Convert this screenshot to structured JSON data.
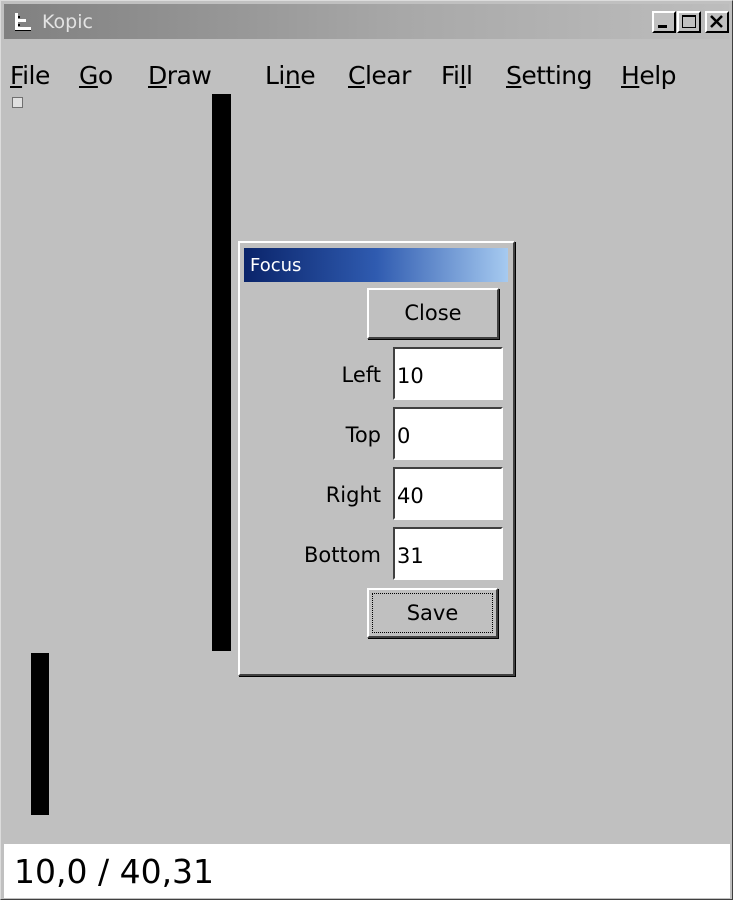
{
  "window": {
    "title": "Kopic",
    "minimize_icon": "minimize-icon",
    "maximize_icon": "maximize-icon",
    "close_icon": "close-icon",
    "app_icon": "app-icon"
  },
  "menu": [
    {
      "mnemonic": "F",
      "rest": "ile"
    },
    {
      "mnemonic": "G",
      "rest": "o"
    },
    {
      "mnemonic": "D",
      "rest": "raw"
    },
    {
      "before": "Li",
      "mnemonic": "n",
      "rest": "e"
    },
    {
      "mnemonic": "C",
      "rest": "lear"
    },
    {
      "before": "Fi",
      "mnemonic": "l",
      "rest": "l"
    },
    {
      "mnemonic": "S",
      "rest": "etting"
    },
    {
      "mnemonic": "H",
      "rest": "elp"
    }
  ],
  "status": {
    "text": "10,0 / 40,31"
  },
  "dialog": {
    "title": "Focus",
    "close_label": "Close",
    "save_label": "Save",
    "fields": {
      "left": {
        "label": "Left",
        "value": "10"
      },
      "top": {
        "label": "Top",
        "value": "0"
      },
      "right": {
        "label": "Right",
        "value": "40"
      },
      "bottom": {
        "label": "Bottom",
        "value": "31"
      }
    }
  },
  "colors": {
    "dialog_title_start": "#0a246a",
    "dialog_title_end": "#a6caf0",
    "face": "#c0c0c0",
    "status_bg": "#ffffff"
  }
}
